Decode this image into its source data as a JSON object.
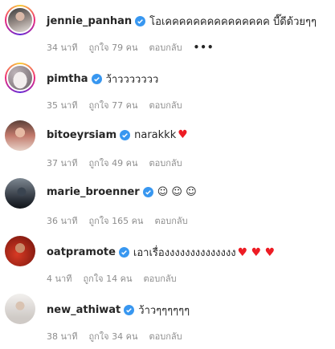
{
  "comments": [
    {
      "username": "jennie_panhan",
      "text": "โอเคคคคคคคคคคคคคคค บี๊ดีด้วยๆๆ",
      "time": "34 นาที",
      "likes": "ถูกใจ 79 คน",
      "reply": "ตอบกลับ",
      "more": "•••",
      "hearts": ""
    },
    {
      "username": "pimtha",
      "text": "ว้าววววววว",
      "time": "35 นาที",
      "likes": "ถูกใจ 77 คน",
      "reply": "ตอบกลับ",
      "hearts": ""
    },
    {
      "username": "bitoeyrsiam",
      "text": "narakkk",
      "time": "37 นาที",
      "likes": "ถูกใจ 49 คน",
      "reply": "ตอบกลับ",
      "hearts": "♥"
    },
    {
      "username": "marie_broenner",
      "text": "☺ ☺ ☺",
      "time": "36 นาที",
      "likes": "ถูกใจ 165 คน",
      "reply": "ตอบกลับ",
      "hearts": ""
    },
    {
      "username": "oatpramote",
      "text": "เอาเรื่องงงงงงงงงงงงงง",
      "time": "4 นาที",
      "likes": "ถูกใจ 14 คน",
      "reply": "ตอบกลับ",
      "hearts": "♥ ♥ ♥"
    },
    {
      "username": "new_athiwat",
      "text": "ว้าวๆๆๆๆๆๆ",
      "time": "38 นาที",
      "likes": "ถูกใจ 34 คน",
      "reply": "ตอบกลับ",
      "hearts": ""
    }
  ],
  "icons": {
    "verified": "verified-badge-icon",
    "more": "more-options-icon"
  },
  "colors": {
    "verified": "#3897f0",
    "meta": "#8e8e8e",
    "heart": "#ed1c24"
  }
}
